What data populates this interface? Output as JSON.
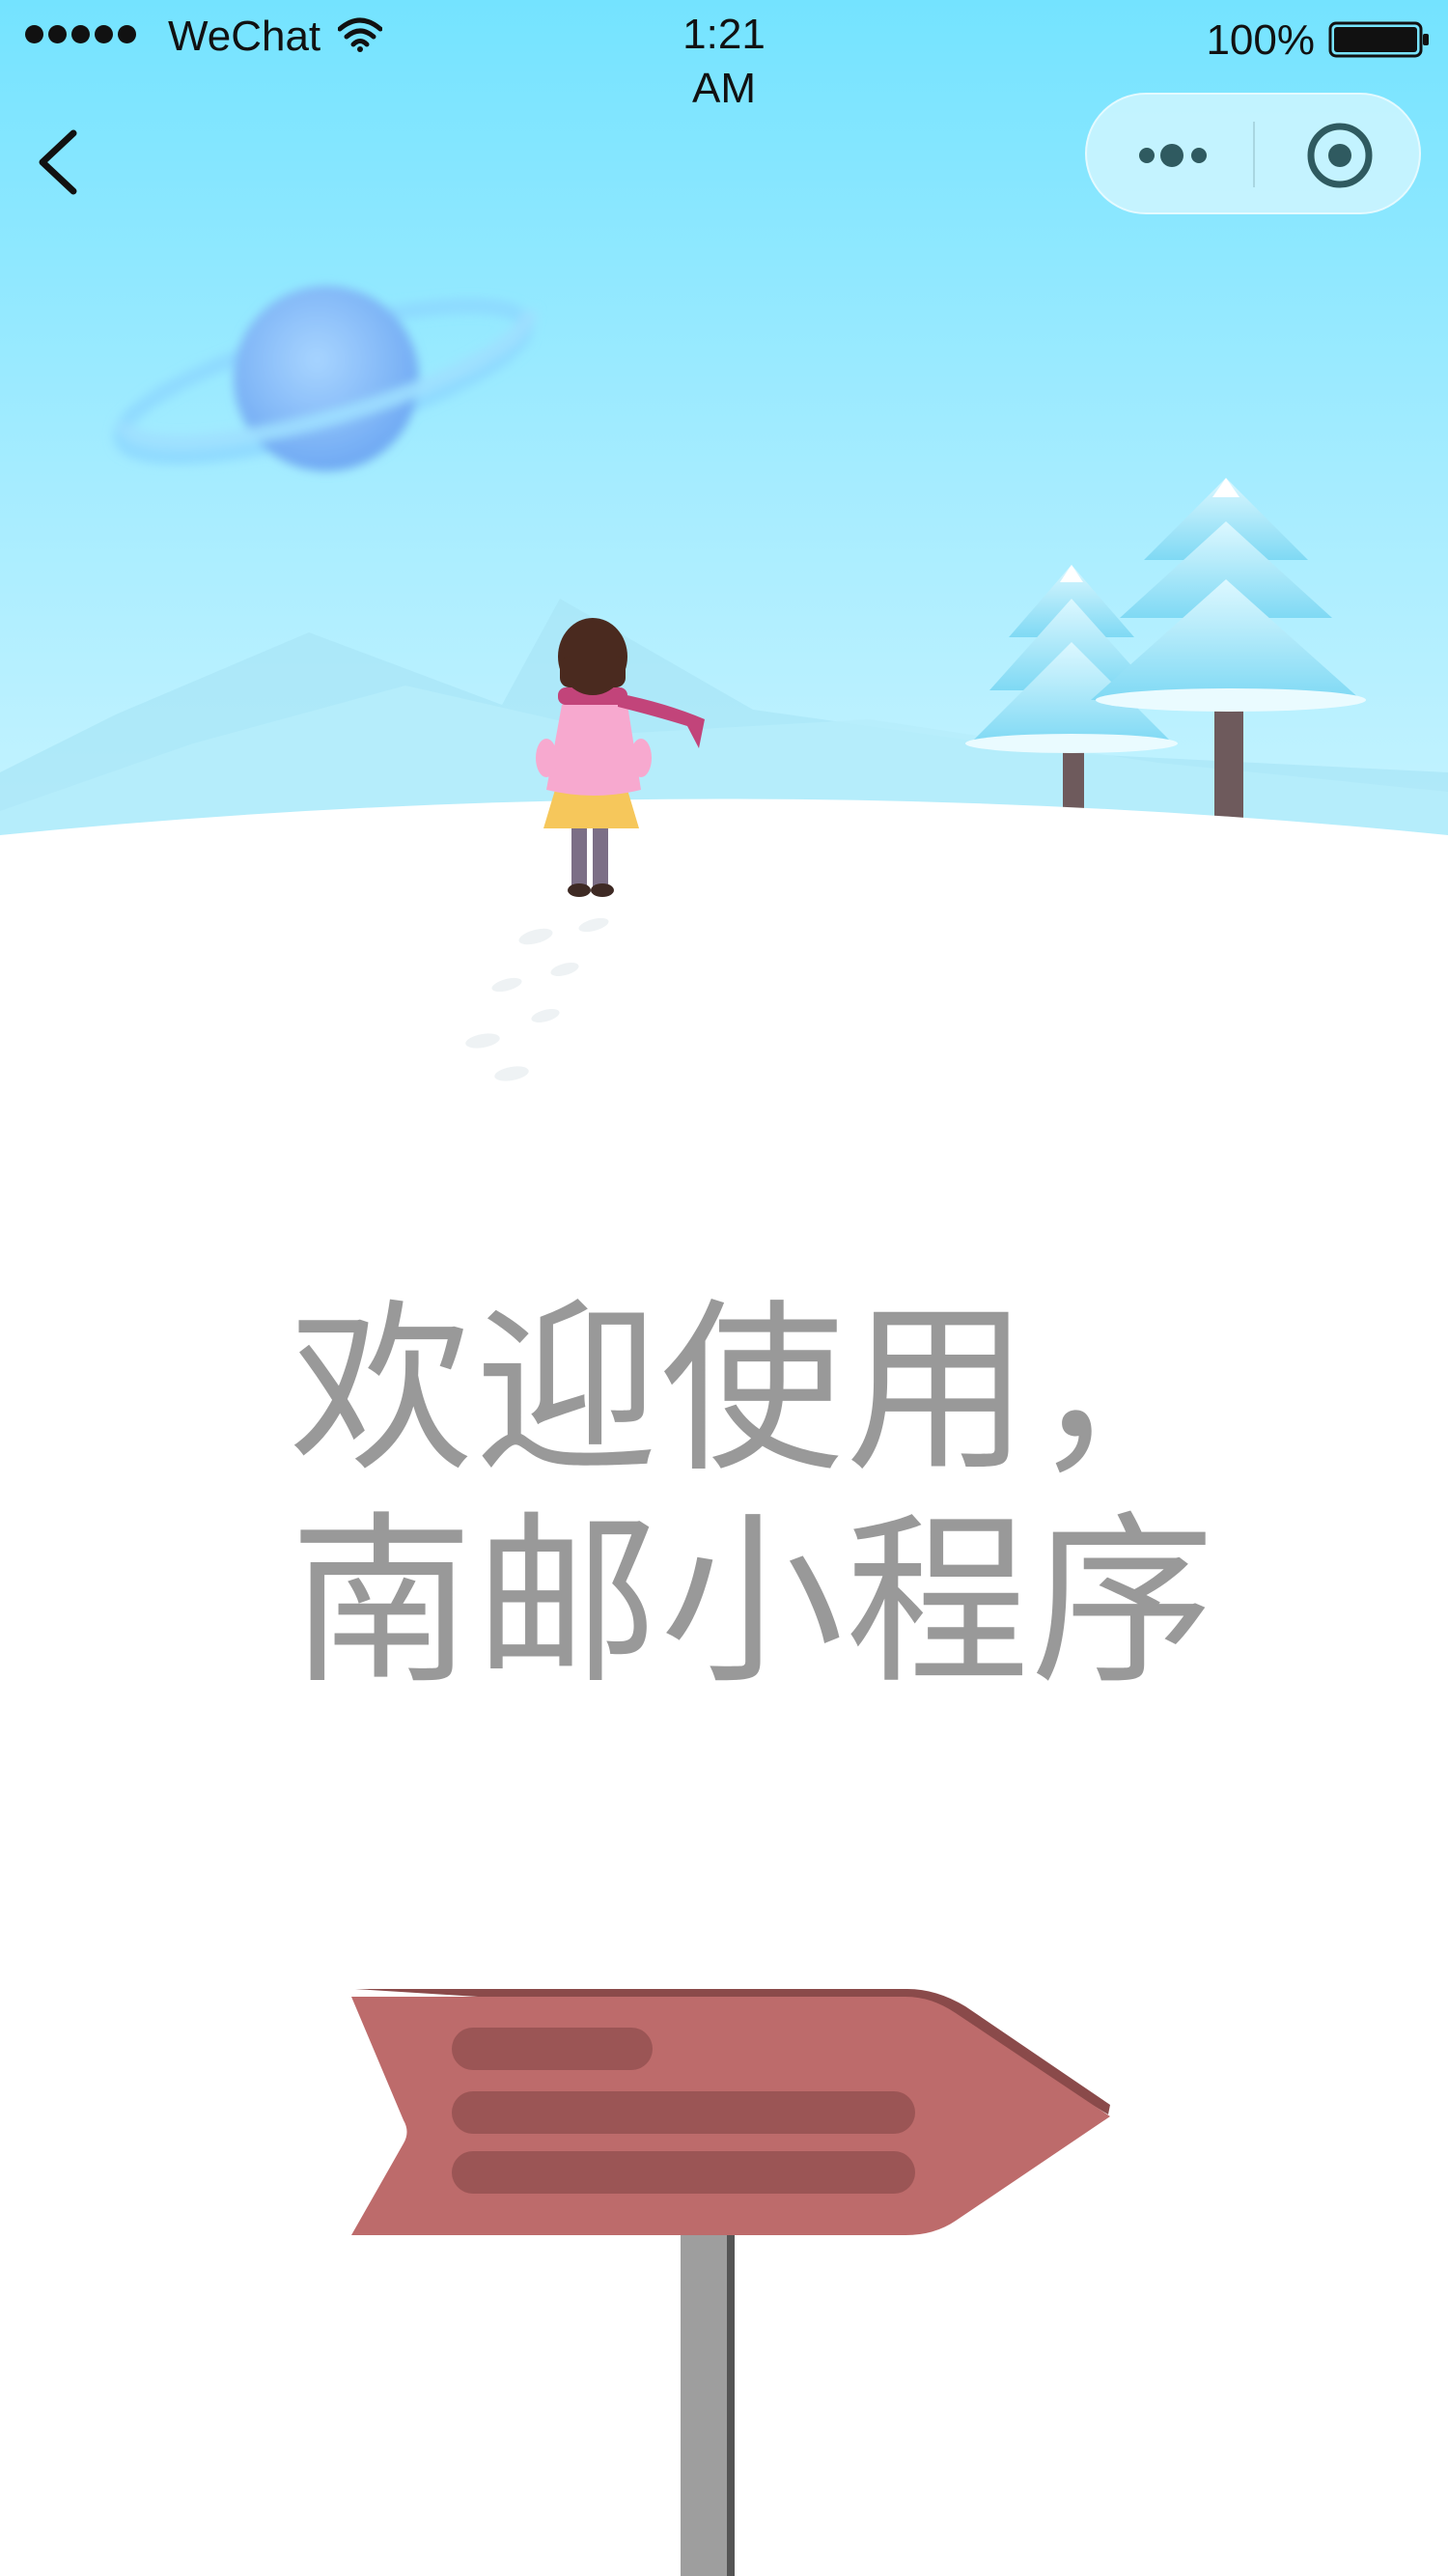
{
  "status_bar": {
    "carrier": "WeChat",
    "time": "1:21\nAM",
    "battery": "100%",
    "icons": [
      "signal-dots-icon",
      "wifi-icon",
      "battery-icon"
    ]
  },
  "nav": {
    "back_icon": "chevron-left-icon",
    "capsule_icons": [
      "more-dots-icon",
      "target-circle-icon"
    ]
  },
  "welcome": {
    "line1": "欢迎使用，",
    "line2": "南邮小程序"
  },
  "colors": {
    "sky_top": "#74E3FF",
    "sky_bottom": "#C4F3FF",
    "welcome_text": "#999999",
    "sign_board": "#BD6B6B",
    "sign_stripes": "#9B5555",
    "post": "#9E9E9E"
  }
}
